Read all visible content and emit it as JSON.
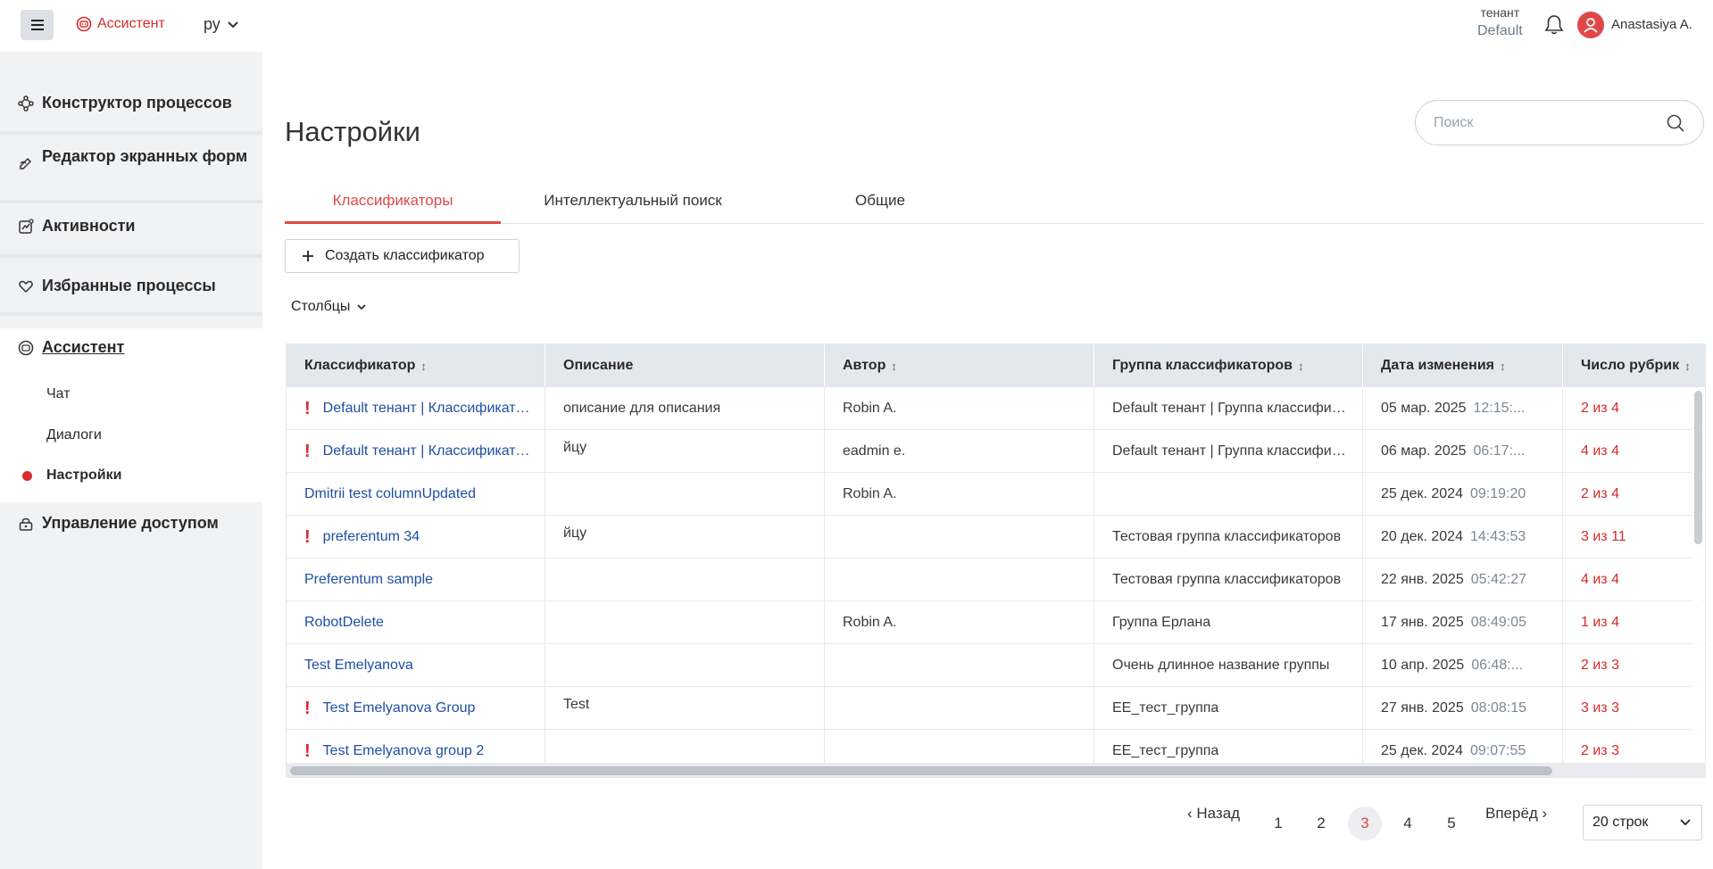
{
  "header": {
    "brand_label": "Ассистент",
    "language": "ру",
    "tenant_label": "тенант",
    "tenant_value": "Default",
    "user_name": "Anastasiya A."
  },
  "sidebar": {
    "items": [
      {
        "label": "Конструктор процессов",
        "icon": "process-builder-icon"
      },
      {
        "label": "Редактор экранных форм",
        "icon": "form-editor-icon"
      },
      {
        "label": "Активности",
        "icon": "activity-icon"
      },
      {
        "label": "Избранные процессы",
        "icon": "heart-icon"
      },
      {
        "label": "Ассистент",
        "icon": "assistant-icon"
      },
      {
        "label": "Управление доступом",
        "icon": "access-icon"
      }
    ],
    "sub_items": [
      {
        "label": "Чат"
      },
      {
        "label": "Диалоги"
      },
      {
        "label": "Настройки"
      }
    ]
  },
  "main": {
    "title": "Настройки",
    "search_placeholder": "Поиск",
    "tabs": [
      {
        "label": "Классификаторы",
        "active": true
      },
      {
        "label": "Интеллектуальный поиск",
        "active": false
      },
      {
        "label": "Общие",
        "active": false
      }
    ],
    "create_label": "Создать классификатор",
    "columns_label": "Столбцы"
  },
  "table": {
    "columns": [
      "Классификатор",
      "Описание",
      "Автор",
      "Группа классификаторов",
      "Дата изменения",
      "Число рубрик"
    ],
    "rows": [
      {
        "name": "Default тенант | Классификатор",
        "warn": true,
        "desc": "описание для описания",
        "author": "Robin A.",
        "group": "Default тенант | Группа классификаторов",
        "date": "05 мар. 2025",
        "time": "12:15:...",
        "count": "2 из 4"
      },
      {
        "name": "Default тенант | Классификатор",
        "warn": true,
        "desc": "йцу",
        "author": "eadmin e.",
        "group": "Default тенант | Группа классификаторов",
        "date": "06 мар. 2025",
        "time": "06:17:...",
        "count": "4 из 4"
      },
      {
        "name": "Dmitrii test columnUpdated",
        "warn": false,
        "desc": "",
        "author": "Robin A.",
        "group": "",
        "date": "25 дек. 2024",
        "time": "09:19:20",
        "count": "2 из 4"
      },
      {
        "name": "preferentum 34",
        "warn": true,
        "desc": "йцу",
        "author": "",
        "group": "Тестовая группа классификаторов",
        "date": "20 дек. 2024",
        "time": "14:43:53",
        "count": "3 из 11"
      },
      {
        "name": "Preferentum sample",
        "warn": false,
        "desc": "",
        "author": "",
        "group": "Тестовая группа классификаторов",
        "date": "22 янв. 2025",
        "time": "05:42:27",
        "count": "4 из 4"
      },
      {
        "name": "RobotDelete",
        "warn": false,
        "desc": "",
        "author": "Robin A.",
        "group": "Группа Ерлана",
        "date": "17 янв. 2025",
        "time": "08:49:05",
        "count": "1 из 4"
      },
      {
        "name": "Test Emelyanova",
        "warn": false,
        "desc": "",
        "author": "",
        "group": "Очень длинное название группы",
        "date": "10 апр. 2025",
        "time": "06:48:...",
        "count": "2 из 3"
      },
      {
        "name": "Test Emelyanova Group",
        "warn": true,
        "desc": "Test",
        "author": "",
        "group": "ЕЕ_тест_группа",
        "date": "27 янв. 2025",
        "time": "08:08:15",
        "count": "3 из 3"
      },
      {
        "name": "Test Emelyanova group 2",
        "warn": true,
        "desc": "",
        "author": "",
        "group": "ЕЕ_тест_группа",
        "date": "25 дек. 2024",
        "time": "09:07:55",
        "count": "2 из 3"
      }
    ]
  },
  "pagination": {
    "prev_label": "Назад",
    "next_label": "Вперёд",
    "pages": [
      "1",
      "2",
      "3",
      "4",
      "5"
    ],
    "current_page": "3",
    "rows_per_page": "20 строк"
  },
  "colors": {
    "accent": "#e04848",
    "link": "#1f4fa3",
    "sidebar_bg": "#f1f2f4",
    "header_row_bg": "#e3e7ee"
  }
}
